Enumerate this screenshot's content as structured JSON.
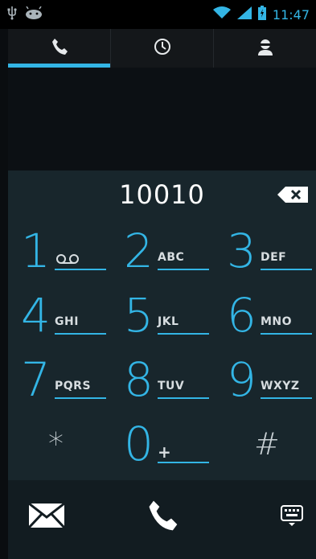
{
  "status_bar": {
    "time": "11:47",
    "icons": [
      "usb-icon",
      "android-icon",
      "wifi-icon",
      "signal-icon",
      "battery-icon"
    ]
  },
  "tabs": [
    {
      "name": "dialer",
      "icon": "phone-icon",
      "active": true
    },
    {
      "name": "call-log",
      "icon": "clock-icon",
      "active": false
    },
    {
      "name": "contacts",
      "icon": "person-icon",
      "active": false
    }
  ],
  "dialer": {
    "digits": "10010",
    "keys": [
      {
        "digit": "1",
        "letters": ""
      },
      {
        "digit": "2",
        "letters": "ABC"
      },
      {
        "digit": "3",
        "letters": "DEF"
      },
      {
        "digit": "4",
        "letters": "GHI"
      },
      {
        "digit": "5",
        "letters": "JKL"
      },
      {
        "digit": "6",
        "letters": "MNO"
      },
      {
        "digit": "7",
        "letters": "PQRS"
      },
      {
        "digit": "8",
        "letters": "TUV"
      },
      {
        "digit": "9",
        "letters": "WXYZ"
      },
      {
        "digit": "*",
        "letters": ""
      },
      {
        "digit": "0",
        "letters": "+"
      },
      {
        "digit": "#",
        "letters": ""
      }
    ]
  },
  "bottom_bar": {
    "icons": [
      "envelope-icon",
      "call-icon",
      "keyboard-icon"
    ]
  },
  "colors": {
    "accent": "#33b5e5",
    "panel": "#18262c",
    "background": "#0a0d10"
  }
}
